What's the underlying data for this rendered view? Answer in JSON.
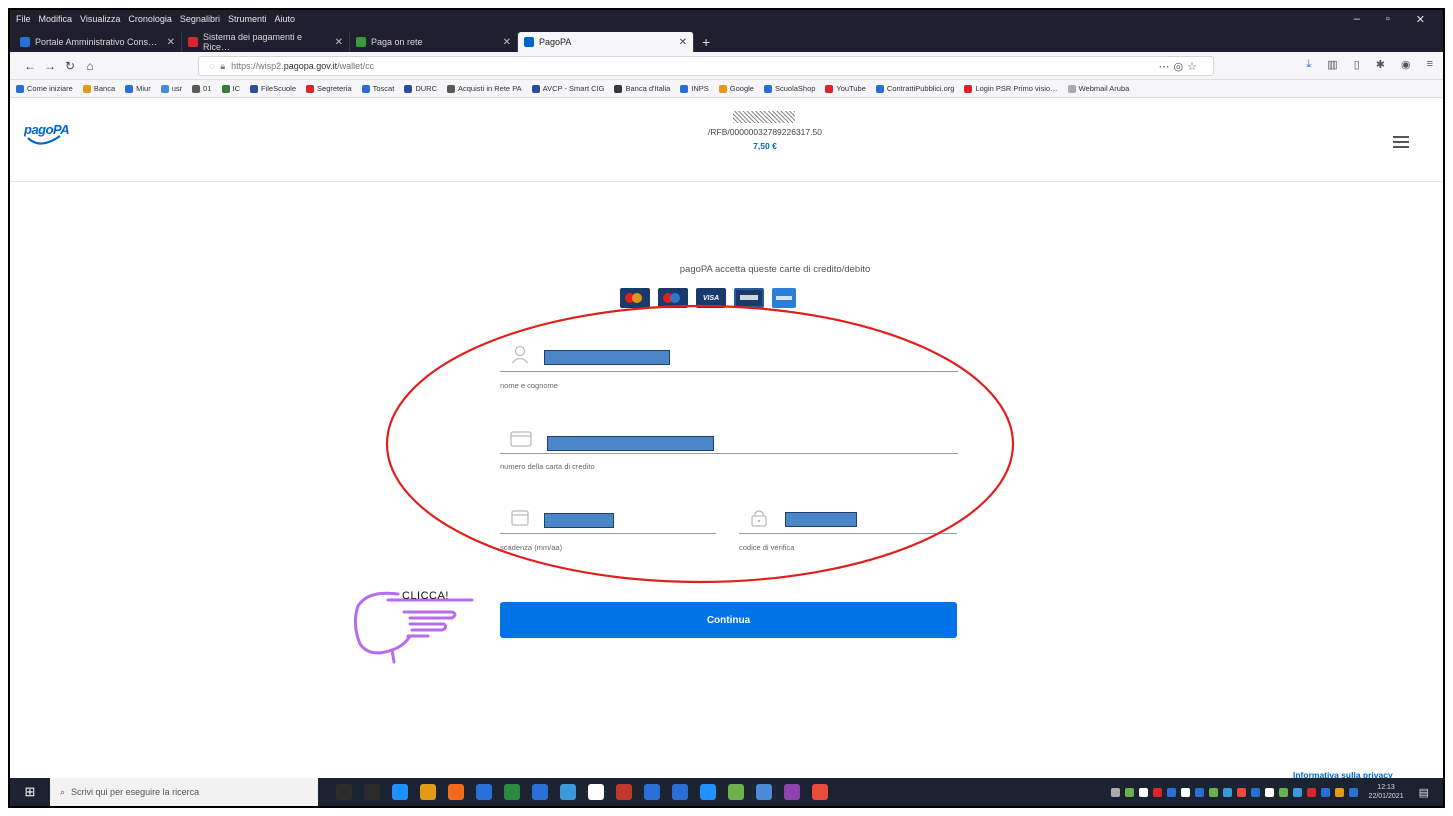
{
  "browser": {
    "menu": [
      "File",
      "Modifica",
      "Visualizza",
      "Cronologia",
      "Segnalibri",
      "Strumenti",
      "Aiuto"
    ],
    "window_controls": [
      "–",
      "▫",
      "✕"
    ],
    "tabs": [
      {
        "label": "Portale Amministrativo Cons…",
        "color": "#2a6fd6"
      },
      {
        "label": "Sistema dei pagamenti e Rice…",
        "color": "#d9262c"
      },
      {
        "label": "Paga on rete",
        "color": "#3a9a3a"
      },
      {
        "label": "PagoPA",
        "color": "#0066cc"
      }
    ],
    "active_tab": 3,
    "address": {
      "prefix": "https://wisp2.",
      "host": "pagopa.gov.it",
      "path": "/wallet/cc"
    },
    "bookmarks": [
      {
        "label": "Come iniziare",
        "color": "#2a6fd6"
      },
      {
        "label": "Banca",
        "color": "#e39b17"
      },
      {
        "label": "Miur",
        "color": "#2a6fd6"
      },
      {
        "label": "usr",
        "color": "#4b8ad6"
      },
      {
        "label": "01",
        "color": "#5a5a5a"
      },
      {
        "label": "IC",
        "color": "#3a7a3a"
      },
      {
        "label": "FileScuole",
        "color": "#2a4fa0"
      },
      {
        "label": "Segreteria",
        "color": "#d9262c"
      },
      {
        "label": "Toscat",
        "color": "#2a6fd6"
      },
      {
        "label": "DURC",
        "color": "#2a4fa0"
      },
      {
        "label": "Acquisti in Rete PA",
        "color": "#5a5a5a"
      },
      {
        "label": "AVCP - Smart CIG",
        "color": "#2a4fa0"
      },
      {
        "label": "Banca d'Italia",
        "color": "#3a3a3a"
      },
      {
        "label": "INPS",
        "color": "#2a6fd6"
      },
      {
        "label": "Google",
        "color": "#e39b17"
      },
      {
        "label": "ScuolaShop",
        "color": "#2a6fd6"
      },
      {
        "label": "YouTube",
        "color": "#d9262c"
      },
      {
        "label": "ContrattiPubblici.org",
        "color": "#2a6fd6"
      },
      {
        "label": "Login PSR Primo visio…",
        "color": "#d9262c"
      },
      {
        "label": "Webmail Aruba",
        "color": "#aaaaaa"
      }
    ]
  },
  "header": {
    "logo": "pagoPA",
    "transaction_code": "/RFB/00000032789226317.50",
    "amount": "7,50 €"
  },
  "payment": {
    "caption": "pagoPA accetta queste carte di credito/debito",
    "card_brands": [
      "mastercard-icon",
      "maestro-icon",
      "visa-icon",
      "visa-electron-icon",
      "amex-icon"
    ],
    "visa_label": "VISA",
    "fields": {
      "name_label": "nome e cognome",
      "card_label": "numero della carta di credito",
      "expiry_label": "scadenza (mm/aa)",
      "cvv_label": "codice di verifica"
    },
    "continue_label": "Continua"
  },
  "annotation": {
    "text": "CLICCA!",
    "ellipse_color": "#e0201b",
    "hand_color": "#b56cf0"
  },
  "footer": {
    "privacy_link": "Informativa sulla privacy"
  },
  "taskbar": {
    "search_placeholder": "Scrivi qui per eseguire la ricerca",
    "time": "12:13",
    "date": "22/01/2021",
    "apps": [
      "#2b2b2b",
      "#2b2b2b",
      "#1e90ff",
      "#e39b17",
      "#f36b1c",
      "#2a6fd6",
      "#2b8a3e",
      "#2a6fd6",
      "#3a9ad9",
      "#ffffff",
      "#c0392b",
      "#2a6fd6",
      "#2a6fd6",
      "#1e90ff",
      "#6ab04c",
      "#4b8ad6",
      "#8e44ad",
      "#e74c3c"
    ]
  }
}
